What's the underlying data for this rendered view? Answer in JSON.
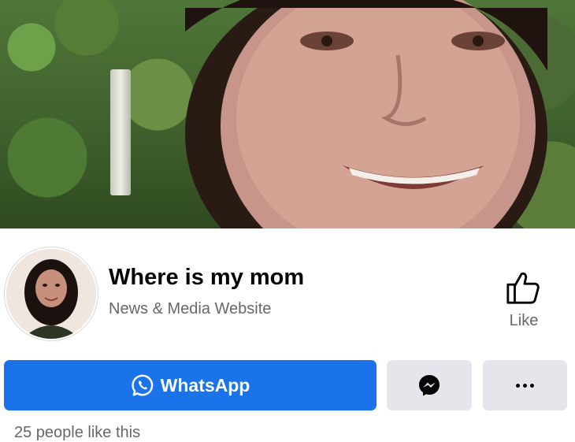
{
  "page": {
    "name": "Where is my mom",
    "category": "News & Media Website",
    "likes_text": "25 people like this"
  },
  "actions": {
    "like_label": "Like",
    "whatsapp_label": "WhatsApp"
  },
  "colors": {
    "primary_button": "#1a73e8",
    "secondary_button": "#e4e6eb",
    "secondary_text": "#65676b"
  },
  "icons": {
    "like": "thumbs-up-icon",
    "whatsapp": "whatsapp-icon",
    "messenger": "messenger-icon",
    "more": "more-dots-icon"
  }
}
